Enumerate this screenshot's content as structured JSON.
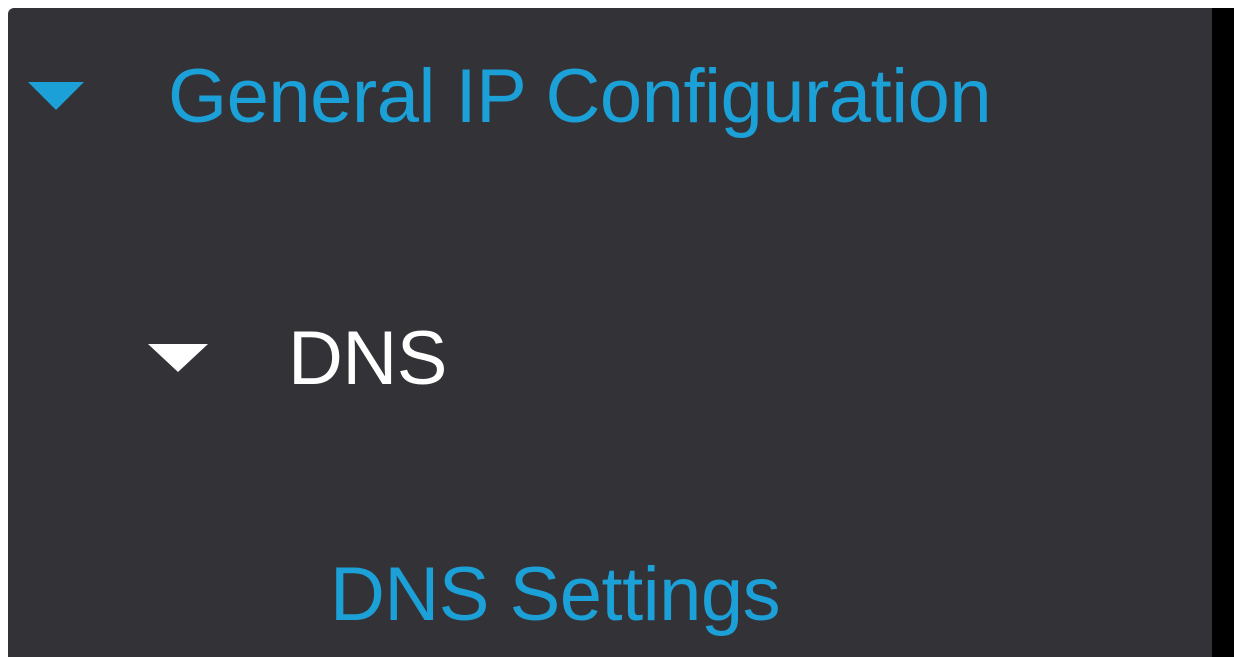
{
  "nav": {
    "general_ip_configuration": {
      "label": "General IP Configuration",
      "icon": "caret-down-icon",
      "expanded": true
    },
    "dns": {
      "label": "DNS",
      "icon": "caret-down-icon",
      "expanded": true
    },
    "dns_settings": {
      "label": "DNS Settings"
    }
  },
  "colors": {
    "background": "#333237",
    "accent": "#1ba0d7",
    "text_primary": "#ffffff",
    "edge": "#000000"
  }
}
